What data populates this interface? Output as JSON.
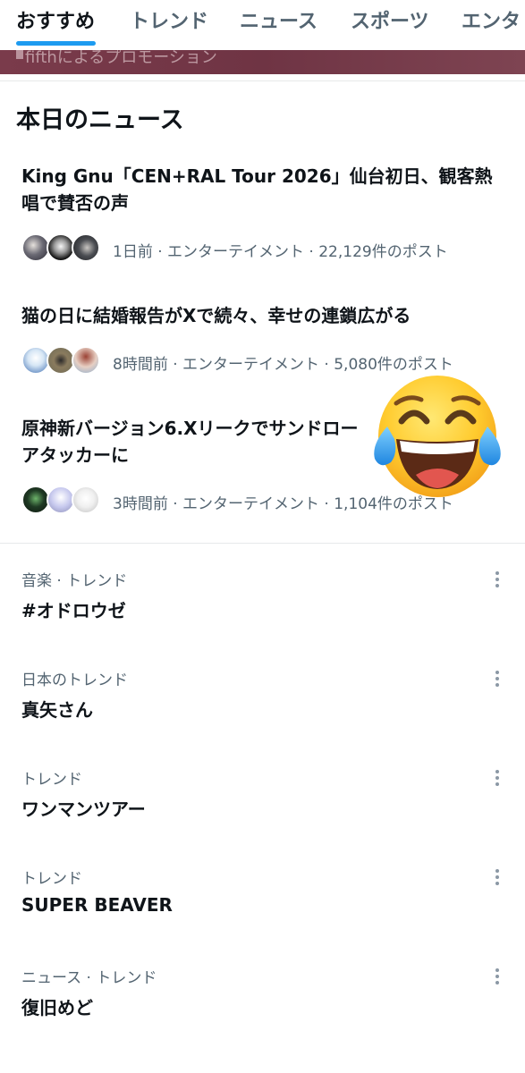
{
  "tabs": [
    {
      "label": "おすすめ",
      "active": true
    },
    {
      "label": "トレンド",
      "active": false
    },
    {
      "label": "ニュース",
      "active": false
    },
    {
      "label": "スポーツ",
      "active": false
    },
    {
      "label": "エンタ",
      "active": false
    }
  ],
  "promo": {
    "label": "fifthによるプロモーション"
  },
  "news_section": {
    "title": "本日のニュース",
    "items": [
      {
        "headline_line1": "King Gnu「CEN+RAL Tour 2026」仙台初日、観客熱",
        "headline_line2": "唱で賛否の声",
        "meta": "1日前 · エンターテイメント · 22,129件のポスト"
      },
      {
        "headline_line1": "猫の日に結婚報告がXで続々、幸せの連鎖広がる",
        "meta": "8時間前 · エンターテイメント · 5,080件のポスト"
      },
      {
        "headline_line1": "原神新バージョン6.Xリークでサンドロー",
        "headline_line2": "アタッカーに",
        "meta": "3時間前 · エンターテイメント · 1,104件のポスト"
      }
    ]
  },
  "trends": [
    {
      "category": "音楽 · トレンド",
      "name": "#オドロウゼ"
    },
    {
      "category": "日本のトレンド",
      "name": "真矢さん"
    },
    {
      "category": "トレンド",
      "name": "ワンマンツアー"
    },
    {
      "category": "トレンド",
      "name": "SUPER BEAVER"
    },
    {
      "category": "ニュース · トレンド",
      "name": "復旧めど"
    }
  ],
  "overlay": {
    "emoji": "face-with-tears-of-joy"
  },
  "colors": {
    "accent": "#1d9bf0",
    "text": "#0f1419",
    "secondary": "#536471"
  }
}
